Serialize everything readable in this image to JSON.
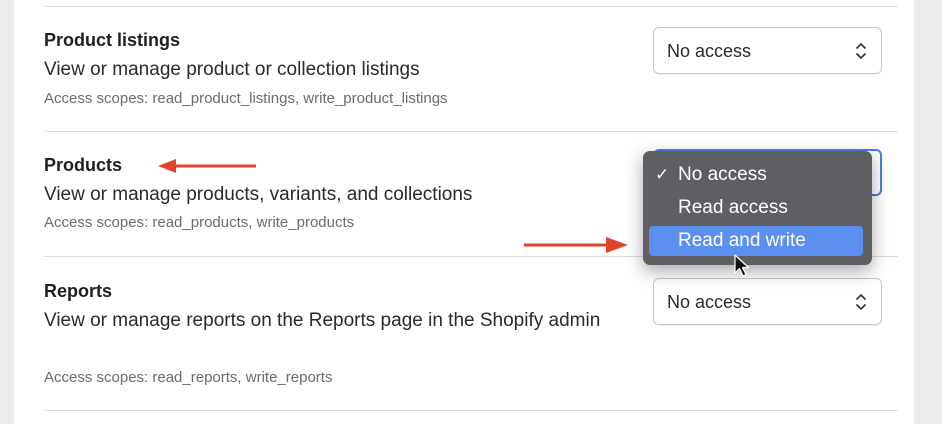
{
  "sections": [
    {
      "title": "Product listings",
      "description": "View or manage product or collection listings",
      "scopes": "Access scopes: read_product_listings, write_product_listings",
      "select_value": "No access"
    },
    {
      "title": "Products",
      "description": "View or manage products, variants, and collections",
      "scopes": "Access scopes: read_products, write_products",
      "select_value": "No access"
    },
    {
      "title": "Reports",
      "description": "View or manage reports on the Reports page in the Shopify admin",
      "scopes": "Access scopes: read_reports, write_reports",
      "select_value": "No access"
    }
  ],
  "dropdown": {
    "options": [
      {
        "label": "No access",
        "check": "✓"
      },
      {
        "label": "Read access",
        "check": ""
      },
      {
        "label": "Read and write",
        "check": ""
      }
    ],
    "highlighted": "Read and write"
  },
  "colors": {
    "annotation_arrow": "#e4432b",
    "menu_background": "#5f5f63",
    "menu_highlight": "#5b8ff0",
    "focus_ring": "#4b7fe0"
  },
  "icons": [
    "select-chevron-icon",
    "checkmark-icon",
    "annotation-arrow-icon",
    "mouse-pointer-icon"
  ]
}
